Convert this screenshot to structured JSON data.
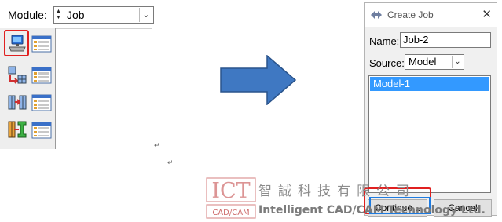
{
  "module_panel": {
    "module_label": "Module:",
    "module_value": "Job"
  },
  "arrow": {
    "color": "#3f78c2"
  },
  "dialog": {
    "title": "Create Job",
    "name_label": "Name:",
    "name_value": "Job-2",
    "source_label": "Source:",
    "source_value": "Model",
    "models": [
      "Model-1"
    ],
    "continue_label": "Continue...",
    "cancel_label": "Cancel",
    "selection_color": "#3399ff"
  },
  "watermark": {
    "logo_text": "ICT",
    "logo_sub": "CAD/CAM",
    "company_cn": "智誠科技有限公司",
    "company_en": "Intelligent CAD/CAM Technology Ltd."
  },
  "highlight_color": "#e02020"
}
